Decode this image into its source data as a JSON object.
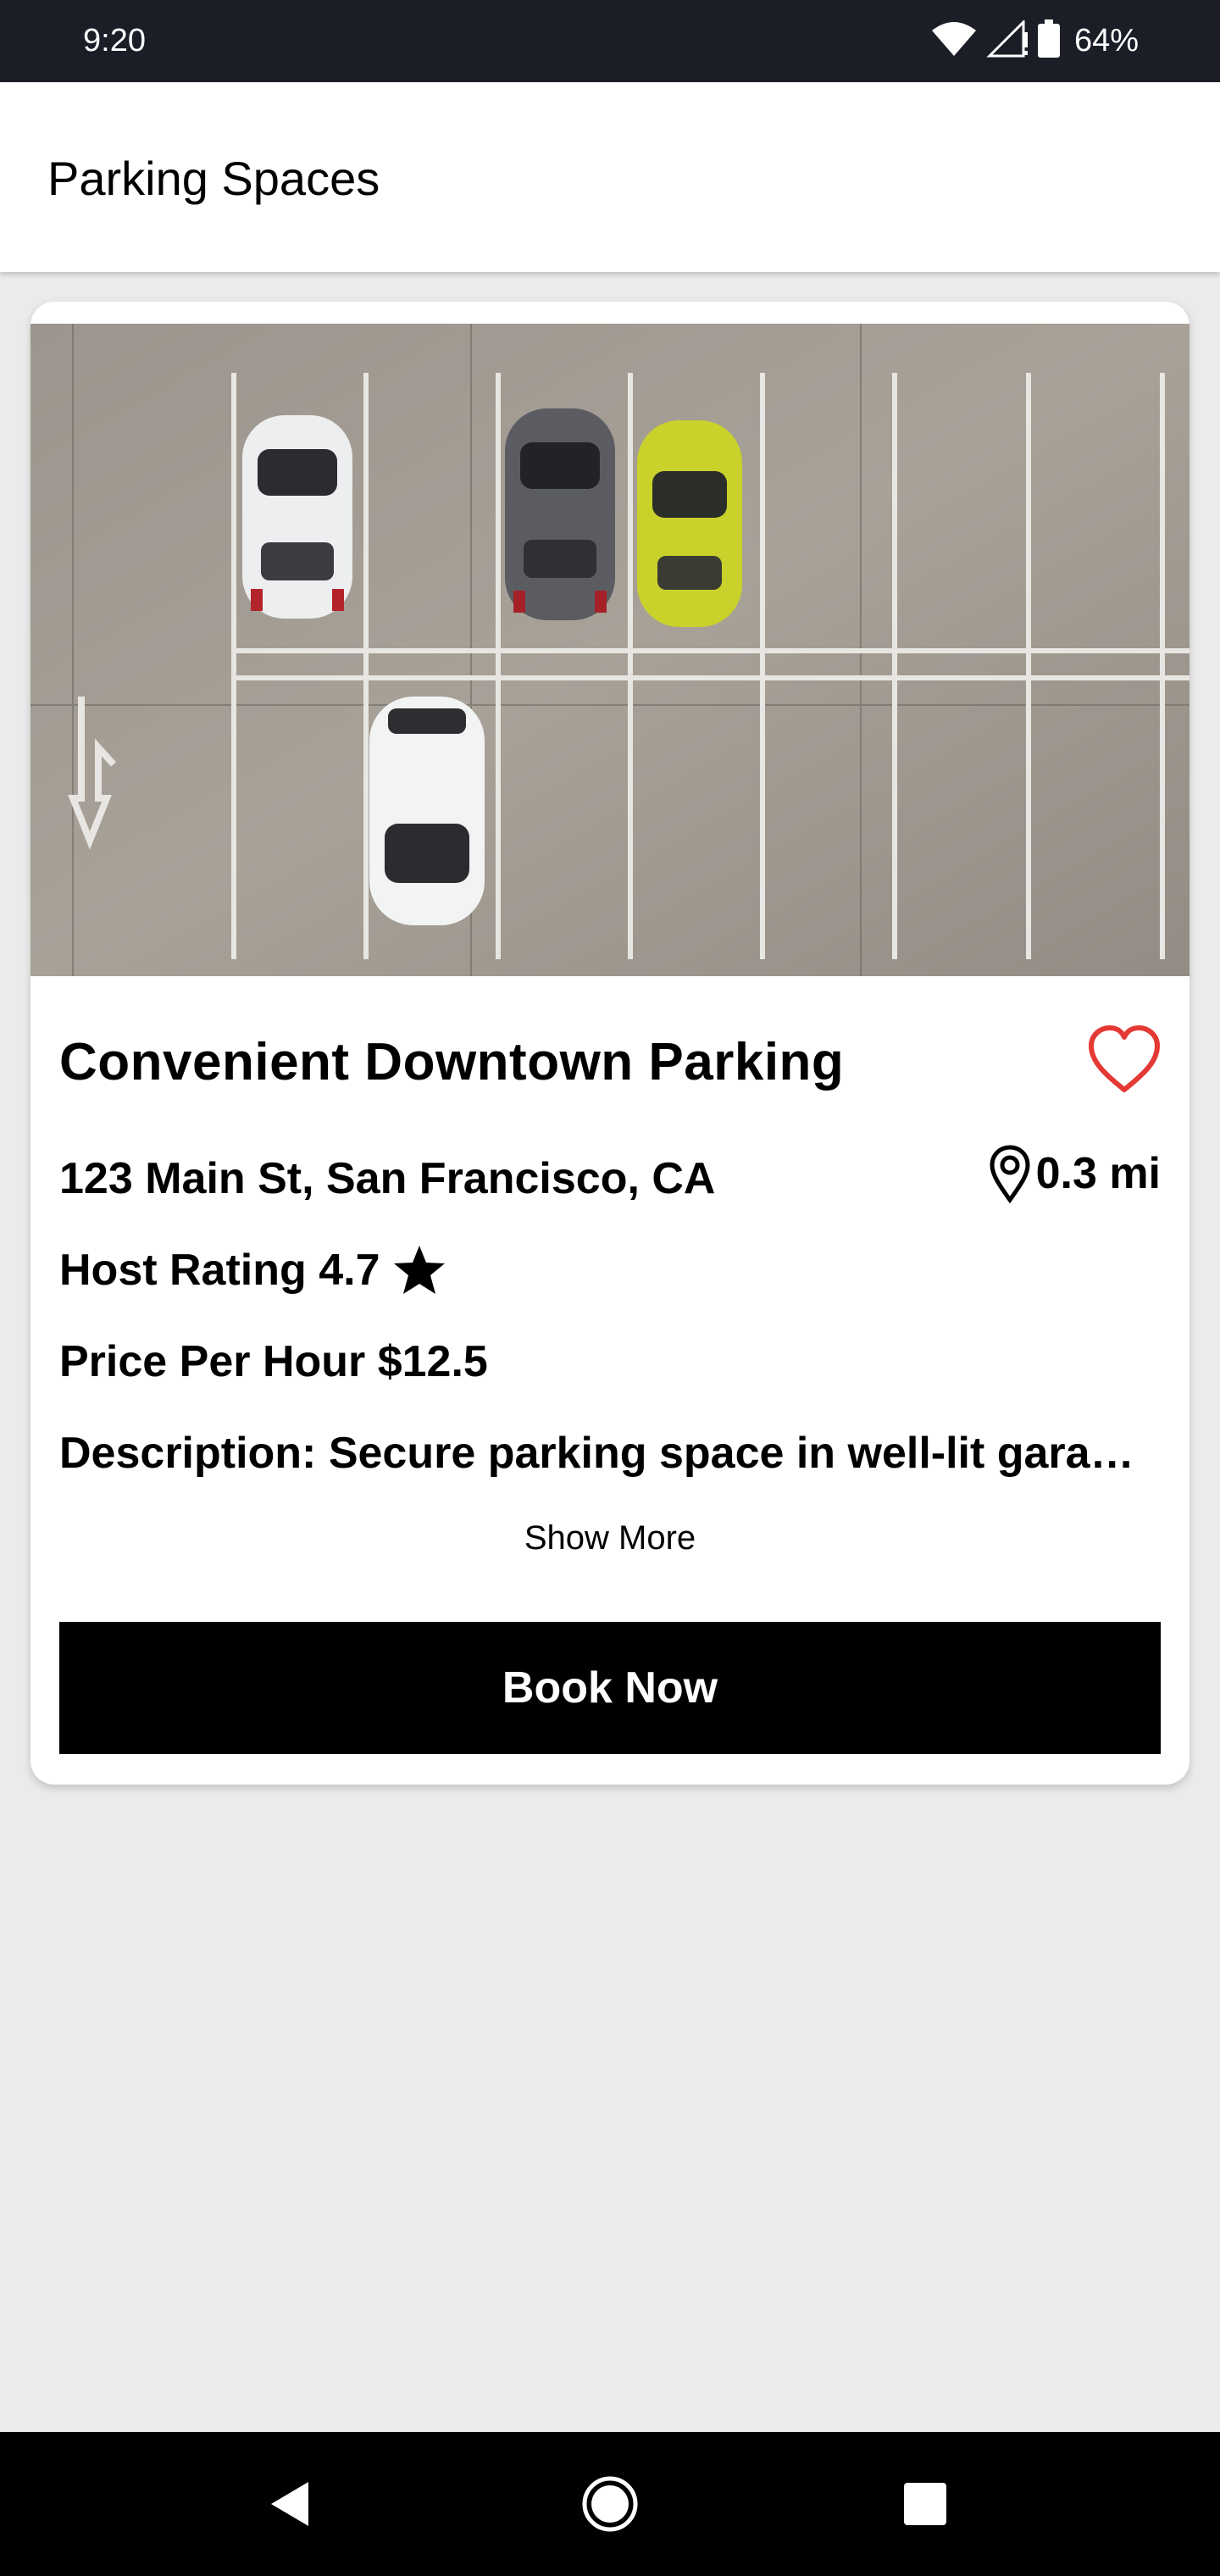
{
  "status_bar": {
    "time": "9:20",
    "battery": "64%",
    "icons": [
      "wifi-icon",
      "signal-icon",
      "battery-icon"
    ]
  },
  "app_bar": {
    "title": "Parking Spaces"
  },
  "listing": {
    "image_icon": "parking-lot-photo",
    "title": "Convenient Downtown Parking",
    "favorite_icon": "heart-outline-icon",
    "favorite_color": "#e53935",
    "address": "123 Main St, San Francisco, CA",
    "distance_icon": "location-pin-icon",
    "distance": "0.3 mi",
    "rating_label": "Host Rating 4.7",
    "rating_icon": "star-icon",
    "price_label": "Price Per Hour $12.5",
    "description": "Description: Secure parking space in well-lit garage. Close to shops and restaurants.",
    "show_more_label": "Show More",
    "book_button_label": "Book Now"
  },
  "nav_bar": {
    "icons": [
      "back-icon",
      "home-icon",
      "recents-icon"
    ]
  }
}
